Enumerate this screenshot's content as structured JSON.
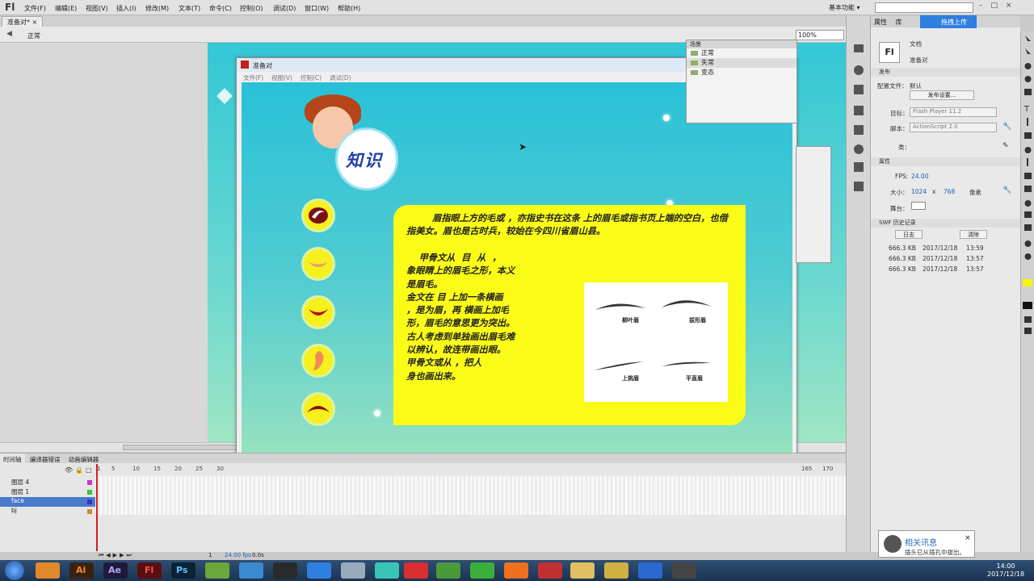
{
  "menubar": {
    "logo": "Fl",
    "items": [
      "文件(F)",
      "编辑(E)",
      "视图(V)",
      "插入(I)",
      "修改(M)",
      "文本(T)",
      "命令(C)",
      "控制(O)",
      "调试(D)",
      "窗口(W)",
      "帮助(H)"
    ],
    "workspace": "基本功能 ▾",
    "search_placeholder": "",
    "upload": "拖拽上传"
  },
  "document": {
    "tab": "准备对*",
    "tab_close": "×",
    "scene": "正常",
    "zoom": "100%"
  },
  "player": {
    "title": "准备对",
    "menu": [
      "文件(F)",
      "视图(V)",
      "控制(C)",
      "调试(D)"
    ],
    "badge": "知识",
    "text_first": "眉指眼上方的毛或  ，亦指史书在这条  上的眉毛或指书页上端的空白，也借指美女。眉也是古时兵，较始在今四川省眉山县。",
    "text_lines": [
      "    甲骨文从  目  从  ，",
      "象眼睛上的眉毛之形，本义",
      "是眉毛。",
      "金文在  目  上加一条横画",
      "，是为眉，再  横画上加毛",
      "形，眉毛的意思更为突出。",
      "古人考虑到单独画出眉毛难",
      "以辨认，故连带画出眼。",
      "甲骨文或从    ，把人",
      "身也画出来。"
    ],
    "brows": [
      "柳叶眉",
      "拔形眉",
      "上挑眉",
      "平直眉"
    ]
  },
  "scene_panel": {
    "header": "场景",
    "scenes": [
      "正常",
      "失常",
      "变态"
    ]
  },
  "properties": {
    "tabs": [
      "属性",
      "库"
    ],
    "doc_label": "文档",
    "doc_name": "准备对",
    "section_publish": "发布",
    "profile_label": "配置文件：",
    "profile_value": "默认",
    "publish_settings": "发布设置...",
    "target_label": "目标：",
    "target_value": "Flash Player 11.2",
    "script_label": "脚本：",
    "script_value": "ActionScript 2.0",
    "class_label": "类：",
    "section_props": "属性",
    "fps_label": "FPS:",
    "fps": "24.00",
    "size_label": "大小：",
    "width": "1024",
    "height": "768",
    "x_label": "x",
    "unit": "像素",
    "stage_label": "舞台：",
    "section_swf": "SWF 历史记录",
    "log_btn": "日志",
    "clear_btn": "清除",
    "history": [
      {
        "size": "666.3 KB",
        "date": "2017/12/18",
        "time": "13:59"
      },
      {
        "size": "666.3 KB",
        "date": "2017/12/18",
        "time": "13:57"
      },
      {
        "size": "666.3 KB",
        "date": "2017/12/18",
        "time": "13:57"
      }
    ]
  },
  "timeline": {
    "tabs": [
      "时间轴",
      "编译器错误",
      "动画编辑器"
    ],
    "ruler": [
      "1",
      "5",
      "10",
      "15",
      "20",
      "25",
      "30"
    ],
    "ruler_right": [
      "165",
      "170"
    ],
    "layers": [
      {
        "name": "图层 4",
        "color": "#cc33cc"
      },
      {
        "name": "图层 1",
        "color": "#33cc33"
      },
      {
        "name": "face",
        "color": "#3333cc"
      },
      {
        "name": "bj",
        "color": "#cc8833"
      }
    ],
    "fps": "24.00 fps",
    "time": "0.0s",
    "frame": "1"
  },
  "notification": {
    "title": "相关讯息",
    "text": "插头已从插孔中拔出。"
  },
  "clock": {
    "time": "14:00",
    "date": "2017/12/18"
  },
  "colors": {
    "accent": "#2f7fe0",
    "card": "#fbfb18",
    "badge_text": "#1f3fa5"
  }
}
